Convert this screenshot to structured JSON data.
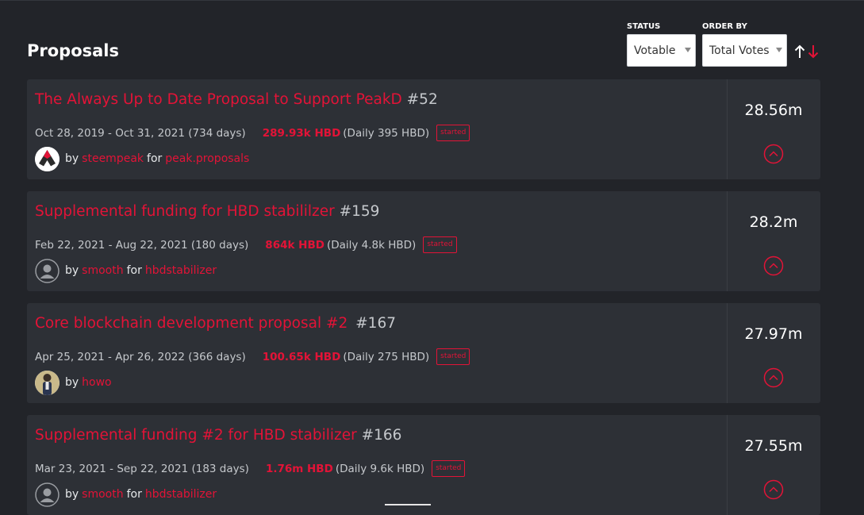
{
  "page": {
    "title": "Proposals"
  },
  "filters": {
    "status_label": "STATUS",
    "status_value": "Votable",
    "order_label": "ORDER BY",
    "order_value": "Total Votes"
  },
  "colors": {
    "accent": "#e31337",
    "background": "#222429",
    "card": "#2d3036"
  },
  "proposals": [
    {
      "title": "The Always Up to Date Proposal to Support PeakD",
      "number": "#52",
      "dates": "Oct 28, 2019 - Oct 31, 2021 (734 days)",
      "amount": "289.93k HBD",
      "daily": "(Daily 395 HBD)",
      "status": "started",
      "by": "by",
      "creator": "steempeak",
      "for": "for",
      "receiver": "peak.proposals",
      "votes": "28.56m",
      "avatar": "peakd-logo"
    },
    {
      "title": "Supplemental funding for HBD stabililzer",
      "number": "#159",
      "dates": "Feb 22, 2021 - Aug 22, 2021 (180 days)",
      "amount": "864k HBD",
      "daily": "(Daily 4.8k HBD)",
      "status": "started",
      "by": "by",
      "creator": "smooth",
      "for": "for",
      "receiver": "hbdstabilizer",
      "votes": "28.2m",
      "avatar": "default-user"
    },
    {
      "title": "Core blockchain development proposal #2",
      "number": "#167",
      "dates": "Apr 25, 2021 - Apr 26, 2022 (366 days)",
      "amount": "100.65k HBD",
      "daily": "(Daily 275 HBD)",
      "status": "started",
      "by": "by",
      "creator": "howo",
      "votes": "27.97m",
      "avatar": "photo"
    },
    {
      "title": "Supplemental funding #2 for HBD stabilizer",
      "number": "#166",
      "dates": "Mar 23, 2021 - Sep 22, 2021 (183 days)",
      "amount": "1.76m HBD",
      "daily": "(Daily 9.6k HBD)",
      "status": "started",
      "by": "by",
      "creator": "smooth",
      "for": "for",
      "receiver": "hbdstabilizer",
      "votes": "27.55m",
      "avatar": "default-user"
    }
  ]
}
